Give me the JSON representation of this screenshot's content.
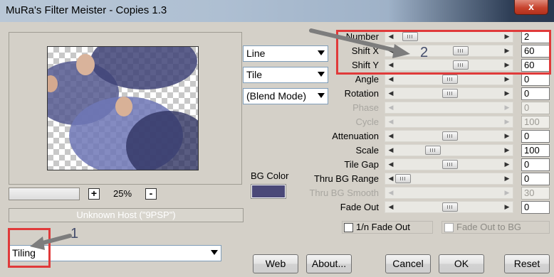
{
  "window": {
    "title": "MuRa's Filter Meister - Copies 1.3",
    "close_label": "x"
  },
  "zoom": {
    "plus": "+",
    "value": "25%",
    "minus": "-"
  },
  "host": {
    "text": "Unknown Host (\"9PSP\")"
  },
  "category": {
    "selected": "Tiling"
  },
  "dropdowns": {
    "mode": "Line",
    "tile": "Tile",
    "blend": "(Blend Mode)"
  },
  "params": [
    {
      "label": "Number",
      "value": "2",
      "enabled": true,
      "level": 0.08
    },
    {
      "label": "Shift X",
      "value": "60",
      "enabled": true,
      "level": 0.62
    },
    {
      "label": "Shift Y",
      "value": "60",
      "enabled": true,
      "level": 0.62
    },
    {
      "label": "Angle",
      "value": "0",
      "enabled": true,
      "level": 0.5
    },
    {
      "label": "Rotation",
      "value": "0",
      "enabled": true,
      "level": 0.5
    },
    {
      "label": "Phase",
      "value": "0",
      "enabled": false,
      "level": 0.5
    },
    {
      "label": "Cycle",
      "value": "100",
      "enabled": false,
      "level": 0.5
    },
    {
      "label": "Attenuation",
      "value": "0",
      "enabled": true,
      "level": 0.5
    },
    {
      "label": "Scale",
      "value": "100",
      "enabled": true,
      "level": 0.32
    },
    {
      "label": "Tile Gap",
      "value": "0",
      "enabled": true,
      "level": 0.5
    },
    {
      "label": "Thru BG Range",
      "value": "0",
      "enabled": true,
      "level": 0.0
    },
    {
      "label": "Thru BG Smooth",
      "value": "30",
      "enabled": false,
      "level": 0.0
    },
    {
      "label": "Fade Out",
      "value": "0",
      "enabled": true,
      "level": 0.5
    }
  ],
  "bg_color": {
    "label": "BG Color",
    "color": "#4a4878"
  },
  "checkboxes": {
    "fade_out_1n": "1/n Fade Out",
    "fade_out_bg": "Fade Out to BG"
  },
  "buttons": {
    "web": "Web",
    "about": "About...",
    "cancel": "Cancel",
    "ok": "OK",
    "reset": "Reset"
  },
  "annotations": {
    "marker_1": "1",
    "marker_2": "2"
  },
  "colors": {
    "annotation_red": "#e03a3a",
    "annotation_arrow": "#7d7d7d"
  }
}
